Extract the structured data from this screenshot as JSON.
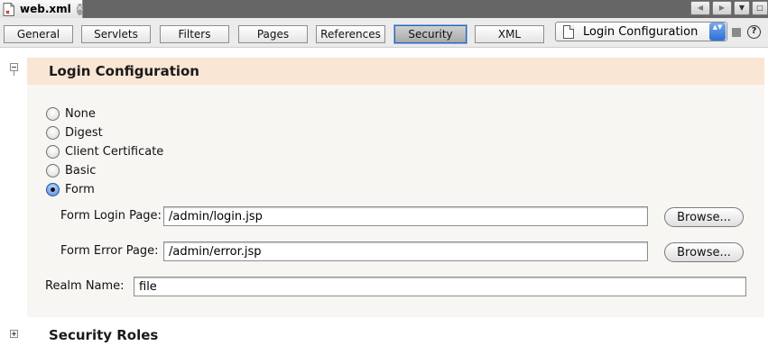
{
  "editor_tab": {
    "file_name": "web.xml",
    "close_glyph": "✕"
  },
  "tab_controls": {
    "prev": "◀",
    "next": "▶",
    "menu": "▼",
    "maximize": "□"
  },
  "toolbar": {
    "views": [
      {
        "label": "General"
      },
      {
        "label": "Servlets"
      },
      {
        "label": "Filters"
      },
      {
        "label": "Pages"
      },
      {
        "label": "References"
      },
      {
        "label": "Security",
        "active": true
      },
      {
        "label": "XML"
      }
    ],
    "section_combo": {
      "label": "Login Configuration",
      "arrows": "▲▼"
    },
    "help": "?"
  },
  "login_config": {
    "title": "Login Configuration",
    "expanded": true,
    "auth_methods": [
      {
        "label": "None",
        "selected": false
      },
      {
        "label": "Digest",
        "selected": false
      },
      {
        "label": "Client Certificate",
        "selected": false
      },
      {
        "label": "Basic",
        "selected": false
      },
      {
        "label": "Form",
        "selected": true
      }
    ],
    "form_login_page": {
      "label": "Form Login Page:",
      "value": "/admin/login.jsp",
      "browse": "Browse..."
    },
    "form_error_page": {
      "label": "Form Error Page:",
      "value": "/admin/error.jsp",
      "browse": "Browse..."
    },
    "realm_name": {
      "label": "Realm Name:",
      "value": "file"
    }
  },
  "security_roles": {
    "title": "Security Roles",
    "expanded": false
  },
  "colors": {
    "section_header_bg": "#f9e6d5",
    "section_body_bg": "#f8f6f3",
    "active_view_border": "#2f63b0",
    "radio_selected": "#4b87dc"
  }
}
